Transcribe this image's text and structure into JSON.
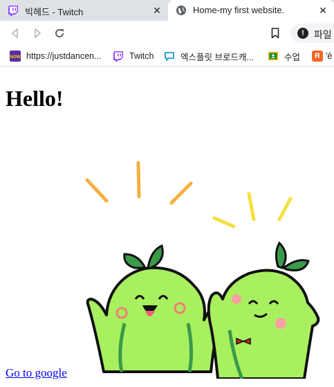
{
  "tabs": [
    {
      "title": "빅헤드 - Twitch",
      "icon": "twitch-icon",
      "close": "✕"
    },
    {
      "title": "Home-my first website.",
      "icon": "globe-icon",
      "close": "✕"
    }
  ],
  "toolbar": {
    "omnibox_text": "파일",
    "omnibox_icon": "info-icon",
    "info_glyph": "!"
  },
  "bookmarks": [
    {
      "label": "https://justdancen...",
      "icon": "now-icon",
      "icon_text": "NOW"
    },
    {
      "label": "Twitch",
      "icon": "twitch-icon"
    },
    {
      "label": "엑스플릿 브로드캐...",
      "icon": "monitor-icon"
    },
    {
      "label": "수업",
      "icon": "classroom-icon"
    },
    {
      "label": "'ē",
      "icon": "r-icon",
      "icon_text": "R"
    }
  ],
  "page": {
    "heading": "Hello!",
    "link_text": "Go to google"
  },
  "colors": {
    "tabstrip": "#dee1e6",
    "twitch": "#9146ff",
    "link": "#0000ee",
    "character_green": "#a8f060",
    "leaf_green": "#3a9a4a"
  }
}
